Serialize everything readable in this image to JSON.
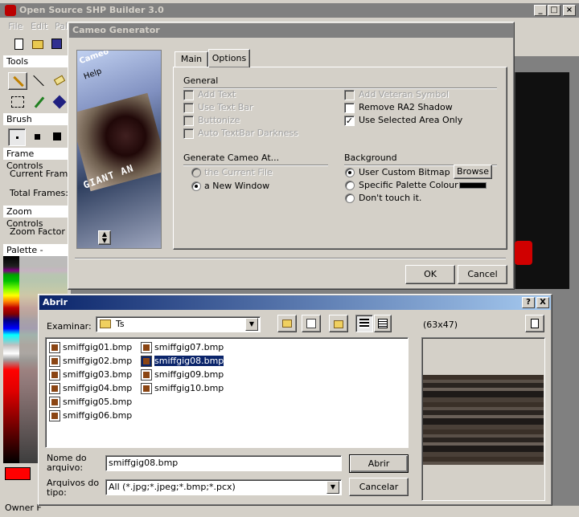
{
  "main_window": {
    "title": "Open Source SHP Builder 3.0",
    "menu": [
      "File",
      "Edit",
      "Pal"
    ],
    "sidebar": {
      "tools_header": "Tools",
      "brush_header": "Brush",
      "frame_controls_header": "Frame Controls",
      "current_frame_label": "Current Frame",
      "total_frames_label": "Total Frames:",
      "zoom_controls_header": "Zoom Controls",
      "zoom_factor_label": "Zoom Factor",
      "palette_header": "Palette - unittem",
      "owner_label": "Owner F"
    }
  },
  "cameo_dialog": {
    "title": "Cameo Generator",
    "preview_text": {
      "menu": "Help",
      "unit_label": "GIANT AN",
      "top_text": "Cameo"
    },
    "tabs": [
      "Main",
      "Options"
    ],
    "active_tab": "Options",
    "general": {
      "header": "General",
      "left_options": [
        {
          "label": "Add Text",
          "checked": false,
          "enabled": false
        },
        {
          "label": "Use Text Bar",
          "checked": false,
          "enabled": false
        },
        {
          "label": "Buttonize",
          "checked": false,
          "enabled": false
        },
        {
          "label": "Auto TextBar Darkness",
          "checked": false,
          "enabled": false
        }
      ],
      "right_options": [
        {
          "label": "Add Veteran Symbol",
          "checked": false,
          "enabled": false
        },
        {
          "label": "Remove RA2 Shadow",
          "checked": false,
          "enabled": true
        },
        {
          "label": "Use Selected Area Only",
          "checked": true,
          "enabled": true
        }
      ]
    },
    "generate_at": {
      "header": "Generate Cameo At...",
      "options": [
        {
          "label": "the Current File",
          "selected": false,
          "enabled": false
        },
        {
          "label": "a New Window",
          "selected": true,
          "enabled": true
        }
      ]
    },
    "background": {
      "header": "Background",
      "options": [
        {
          "label": "User Custom Bitmap",
          "selected": true
        },
        {
          "label": "Specific Palette Colour",
          "selected": false
        },
        {
          "label": "Don't touch it.",
          "selected": false
        }
      ],
      "browse_label": "Browse",
      "colour": "#000000"
    },
    "ok_label": "OK",
    "cancel_label": "Cancel"
  },
  "open_dialog": {
    "title": "Abrir",
    "look_in_label": "Examinar:",
    "look_in_value": "Ts",
    "preview_size": "(63x47)",
    "files": [
      "smiffgig01.bmp",
      "smiffgig02.bmp",
      "smiffgig03.bmp",
      "smiffgig04.bmp",
      "smiffgig05.bmp",
      "smiffgig06.bmp",
      "smiffgig07.bmp",
      "smiffgig08.bmp",
      "smiffgig09.bmp",
      "smiffgig10.bmp"
    ],
    "selected_file": "smiffgig08.bmp",
    "filename_label_1": "Nome do",
    "filename_label_2": "arquivo:",
    "filename_value": "smiffgig08.bmp",
    "filetype_label_1": "Arquivos do",
    "filetype_label_2": "tipo:",
    "filetype_value": "All (*.jpg;*.jpeg;*.bmp;*.pcx)",
    "open_label": "Abrir",
    "cancel_label": "Cancelar",
    "title_buttons": [
      "?",
      "X"
    ]
  },
  "colors": {
    "title_active": "#0a246a",
    "face": "#d4d0c8",
    "selection": "#0a246a"
  }
}
